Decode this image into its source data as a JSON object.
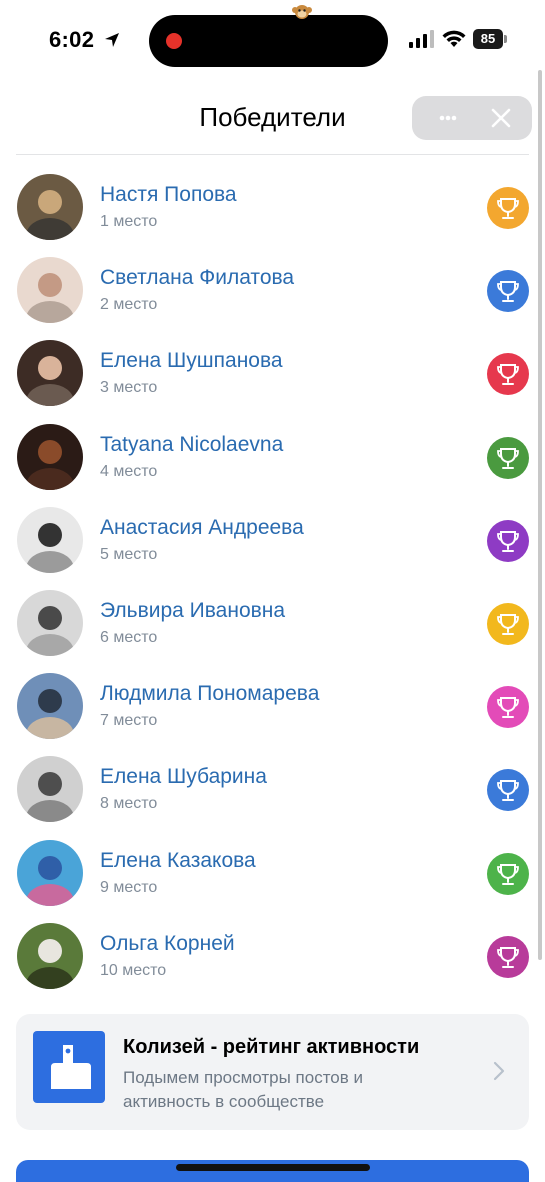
{
  "status_bar": {
    "time": "6:02",
    "battery": "85"
  },
  "header": {
    "title": "Победители"
  },
  "winners": [
    {
      "name": "Настя Попова",
      "place": "1 место",
      "badge_color": "#f3a72f",
      "avatar_palette": [
        "#6b5a43",
        "#c9a77a",
        "#3f3b35"
      ]
    },
    {
      "name": "Светлана Филатова",
      "place": "2 место",
      "badge_color": "#3b7ad9",
      "avatar_palette": [
        "#e9d9cf",
        "#c49a85",
        "#b7a79c"
      ]
    },
    {
      "name": "Елена Шушпанова",
      "place": "3 место",
      "badge_color": "#e6384d",
      "avatar_palette": [
        "#3d2c25",
        "#d9b39a",
        "#6a5a50"
      ]
    },
    {
      "name": "Tatyana Nicolaevna",
      "place": "4 место",
      "badge_color": "#4a9a3f",
      "avatar_palette": [
        "#2b1b16",
        "#8a4b2a",
        "#4a2a1e"
      ]
    },
    {
      "name": "Анастасия Андреева",
      "place": "5 место",
      "badge_color": "#8e3bc4",
      "avatar_palette": [
        "#e8e8e8",
        "#333333",
        "#9b9b9b"
      ]
    },
    {
      "name": "Эльвира Ивановна",
      "place": "6 место",
      "badge_color": "#f2b81d",
      "avatar_palette": [
        "#d8d8d8",
        "#4a4a4a",
        "#a8a8a8"
      ]
    },
    {
      "name": "Людмила Пономарева",
      "place": "7 место",
      "badge_color": "#e34bb8",
      "avatar_palette": [
        "#6f8fb8",
        "#2e3b4c",
        "#c7b6a2"
      ]
    },
    {
      "name": "Елена Шубарина",
      "place": "8 место",
      "badge_color": "#3b7ad9",
      "avatar_palette": [
        "#d0d0d0",
        "#4e4e4e",
        "#8a8a8a"
      ]
    },
    {
      "name": "Елена Казакова",
      "place": "9 место",
      "badge_color": "#4db34a",
      "avatar_palette": [
        "#4aa4d8",
        "#2f5fa8",
        "#c86a9e"
      ]
    },
    {
      "name": "Ольга Корней",
      "place": "10 место",
      "badge_color": "#b83b9a",
      "avatar_palette": [
        "#5a7a3a",
        "#e8e6df",
        "#33401f"
      ]
    }
  ],
  "promo": {
    "title": "Колизей - рейтинг активности",
    "description": "Подымем просмотры постов и активность в сообществе"
  },
  "icons": {
    "trophy": "trophy-icon",
    "more": "more-icon",
    "close": "close-icon",
    "chevron": "chevron-right-icon",
    "location": "location-arrow-icon",
    "signal": "signal-icon",
    "wifi": "wifi-icon"
  }
}
